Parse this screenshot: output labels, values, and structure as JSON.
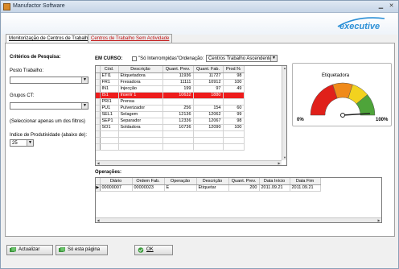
{
  "window": {
    "title": "Manufactor Software"
  },
  "logo": {
    "text": "executive",
    "color": "#2a8fd6"
  },
  "tabs": [
    {
      "label": "Monitorização de Centros de Trabalho"
    },
    {
      "label": "Centros de Trabalho Sem Actividade"
    }
  ],
  "filters": {
    "heading": "Critérios de Pesquisa:",
    "posto_label": "Posto Trabalho:",
    "posto_value": "",
    "grupos_label": "Grupos CT:",
    "grupos_value": "",
    "note": "(Seleccionar apenas um dos filtros)",
    "indice_label": "Indice de Produtividade (abaixo de):",
    "indice_value": "25"
  },
  "em_curso": {
    "heading": "EM CURSO:",
    "checkbox_label": "\"Só Interrompidas\"",
    "ordenacao_label": "Ordenação:",
    "ordenacao_value": "Centros Trabalho Ascendente",
    "columns": [
      "Cód.",
      "Descrição",
      "Quant. Prev.",
      "Quant. Fab.",
      "Prod.%"
    ],
    "rows": [
      {
        "cod": "ETI1",
        "desc": "Etiquetadora",
        "prev": "11936",
        "fab": "11727",
        "prod": "98",
        "highlight": false
      },
      {
        "cod": "FR1",
        "desc": "Fresadora",
        "prev": "11111",
        "fab": "10912",
        "prod": "100",
        "highlight": false
      },
      {
        "cod": "IN1",
        "desc": "Injecção",
        "prev": "199",
        "fab": "97",
        "prod": "49",
        "highlight": false
      },
      {
        "cod": "IS1",
        "desc": "Inserir 1",
        "prev": "10632",
        "fab": "1880",
        "prod": "",
        "highlight": true
      },
      {
        "cod": "PRI1",
        "desc": "Prensa",
        "prev": "",
        "fab": "",
        "prod": "",
        "highlight": false
      },
      {
        "cod": "PU1",
        "desc": "Pulverizador",
        "prev": "256",
        "fab": "154",
        "prod": "60",
        "highlight": false
      },
      {
        "cod": "SEL1",
        "desc": "Selagem",
        "prev": "12136",
        "fab": "12062",
        "prod": "99",
        "highlight": false
      },
      {
        "cod": "SEP1",
        "desc": "Separador",
        "prev": "12336",
        "fab": "12067",
        "prod": "98",
        "highlight": false
      },
      {
        "cod": "SO1",
        "desc": "Soldadora",
        "prev": "10736",
        "fab": "12090",
        "prod": "100",
        "highlight": false
      }
    ]
  },
  "gauge": {
    "title": "Etiquetadora",
    "min_label": "0%",
    "max_label": "100%",
    "value": 98,
    "colors": {
      "red": "#e0201a",
      "orange": "#f08a1a",
      "yellow": "#f2d21e",
      "green": "#4ea43a"
    }
  },
  "operacoes": {
    "heading": "Operações:",
    "columns": [
      "Diário",
      "Ordem Fab.",
      "Operação",
      "Descrição",
      "Quant. Prev.",
      "Data Início",
      "Data Fim"
    ],
    "rows": [
      {
        "diario": "00000007",
        "ordem": "00000023",
        "operacao": "E",
        "desc": "Etiquetar",
        "prev": "200",
        "inicio": "2011.09.21",
        "fim": "2011.09.21"
      }
    ]
  },
  "buttons": {
    "actualizar": "Actualizar",
    "so_esta": "Só esta página",
    "ok": "OK"
  }
}
